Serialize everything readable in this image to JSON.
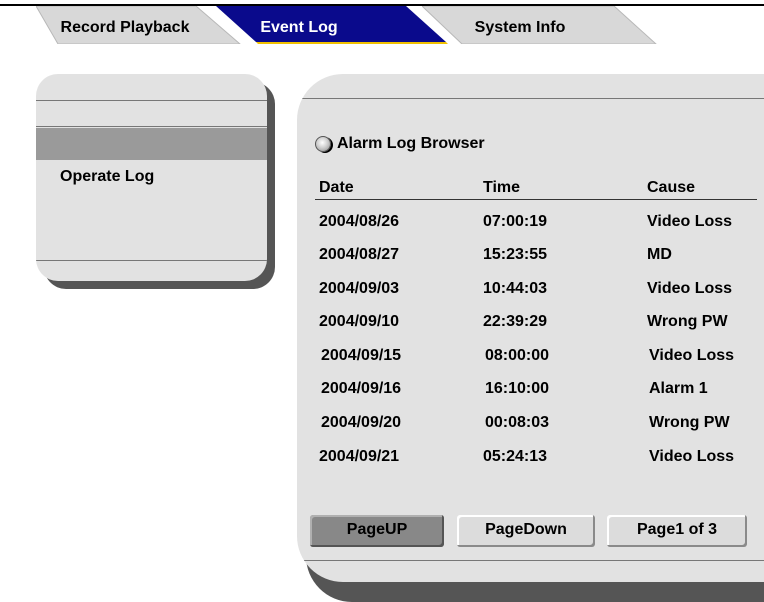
{
  "tabs": [
    {
      "label": "Record Playback",
      "active": false
    },
    {
      "label": "Event Log",
      "active": true
    },
    {
      "label": "System Info",
      "active": false
    }
  ],
  "sidebar": {
    "items": [
      {
        "label": "",
        "selected": true
      },
      {
        "label": "Operate Log",
        "selected": false
      }
    ]
  },
  "browser": {
    "title": "Alarm Log Browser",
    "columns": [
      "Date",
      "Time",
      "Cause"
    ],
    "rows": [
      {
        "date": "2004/08/26",
        "time": "07:00:19",
        "cause": "Video Loss"
      },
      {
        "date": "2004/08/27",
        "time": "15:23:55",
        "cause": "MD"
      },
      {
        "date": "2004/09/03",
        "time": "10:44:03",
        "cause": "Video Loss"
      },
      {
        "date": "2004/09/10",
        "time": "22:39:29",
        "cause": "Wrong PW"
      },
      {
        "date": "2004/09/15",
        "time": "08:00:00",
        "cause": "Video Loss"
      },
      {
        "date": "2004/09/16",
        "time": "16:10:00",
        "cause": "Alarm 1"
      },
      {
        "date": "2004/09/20",
        "time": "00:08:03",
        "cause": "Wrong PW"
      },
      {
        "date": "2004/09/21",
        "time": "05:24:13",
        "cause": "Video Loss"
      }
    ],
    "buttons": {
      "page_up": "PageUP",
      "page_down": "PageDown",
      "page_indicator": "Page1 of 3"
    }
  },
  "colors": {
    "active_tab": "#0a0a8c",
    "active_tab_accent": "#f0c000",
    "inactive_tab": "#d8d8d8",
    "panel": "#e2e2e2",
    "selection": "#9a9a9a"
  }
}
